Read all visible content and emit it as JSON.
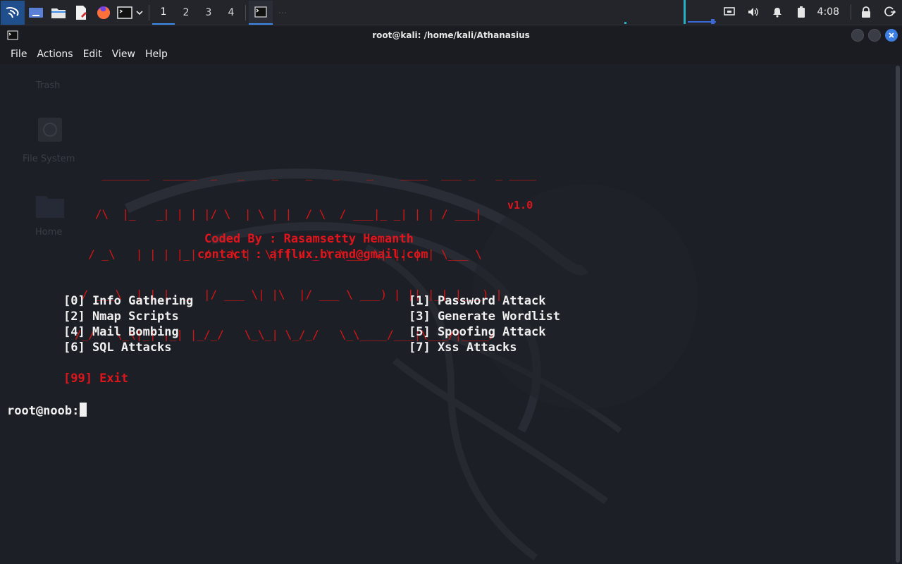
{
  "panel": {
    "workspaces": [
      "1",
      "2",
      "3",
      "4"
    ],
    "active_workspace": "1",
    "clock": "4:08",
    "dots": "⋯"
  },
  "window": {
    "title": "root@kali: /home/kali/Athanasius",
    "menu": [
      "File",
      "Actions",
      "Edit",
      "View",
      "Help"
    ]
  },
  "desktop": {
    "icons": [
      "Trash",
      "File System",
      "Home"
    ]
  },
  "terminal": {
    "banner_lines": [
      "    _______  _____  _   _    _    _   _    _    ____  ___ _   _ ____",
      "   /\\  |_   _| | | |/ \\  | \\ | |  / \\  / ___|_ _| | | / ___|",
      "  / _\\   | | | |_| / _ \\ |  \\| | / _ \\ \\___ \\| || | | \\___ \\",
      " / ___\\  | | |  _  |/ ___ \\| |\\  |/ ___ \\ ___) | || |_| |___) |",
      "/_/   \\_\\|_| |_| |_/_/   \\_\\_| \\_/_/   \\_\\____/___|\\___/|____/"
    ],
    "version": "v1.0",
    "coded_by": "Coded By : Rasamsetty Hemanth",
    "contact": "contact : afflux.brand@gmail.com",
    "options_left": [
      "[0] Info Gathering",
      "[2] Nmap Scripts",
      "[4] Mail Bombing",
      "[6] SQL Attacks"
    ],
    "options_right": [
      "[1] Password Attack",
      "[3] Generate Wordlist",
      "[5] Spoofing Attack",
      "[7] Xss Attacks"
    ],
    "exit": "[99] Exit",
    "prompt": "root@noob:"
  },
  "colors": {
    "accent": "#3d8be8",
    "banner_red": "#e0151c",
    "text": "#f0f0f0",
    "background": "#1d1f26"
  }
}
